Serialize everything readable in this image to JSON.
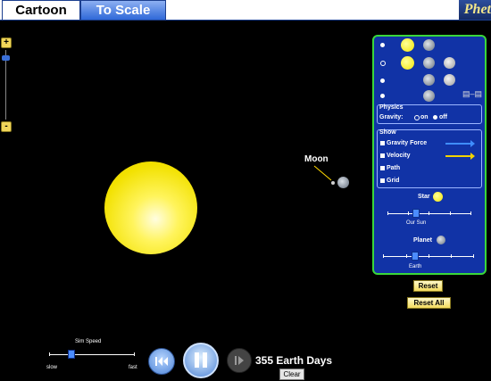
{
  "tabs": [
    {
      "label": "Cartoon",
      "active": true
    },
    {
      "label": "To Scale",
      "active": false
    }
  ],
  "logo": {
    "text": "Phet"
  },
  "zoom": {
    "plus": "+",
    "minus": "-"
  },
  "scene": {
    "moon_label": "Moon"
  },
  "panel": {
    "body_sets": [
      {
        "selected": true,
        "bodies": [
          "star",
          "planet"
        ]
      },
      {
        "selected": false,
        "bodies": [
          "star",
          "planet",
          "moon"
        ]
      },
      {
        "selected": false,
        "bodies": [
          "planet",
          "moon"
        ]
      },
      {
        "selected": false,
        "bodies": [
          "planet",
          "satellite"
        ]
      }
    ],
    "physics": {
      "title": "Physics",
      "gravity_label": "Gravity:",
      "on_label": "on",
      "off_label": "off",
      "gravity_on": false
    },
    "show": {
      "title": "Show",
      "items": [
        {
          "label": "Gravity Force",
          "checked": true,
          "arrow_color": "#3f8dff"
        },
        {
          "label": "Velocity",
          "checked": true,
          "arrow_color": "#f2d300"
        },
        {
          "label": "Path",
          "checked": true
        },
        {
          "label": "Grid",
          "checked": true
        }
      ]
    },
    "star": {
      "label": "Star",
      "slider_value_label": "Our Sun"
    },
    "planet": {
      "label": "Planet",
      "slider_value_label": "Earth"
    }
  },
  "buttons": {
    "reset": "Reset",
    "reset_all": "Reset All",
    "clear": "Clear"
  },
  "sim_speed": {
    "label": "Sim Speed",
    "slow": "slow",
    "fast": "fast",
    "value": 0.25
  },
  "time": {
    "display": "355 Earth Days"
  }
}
